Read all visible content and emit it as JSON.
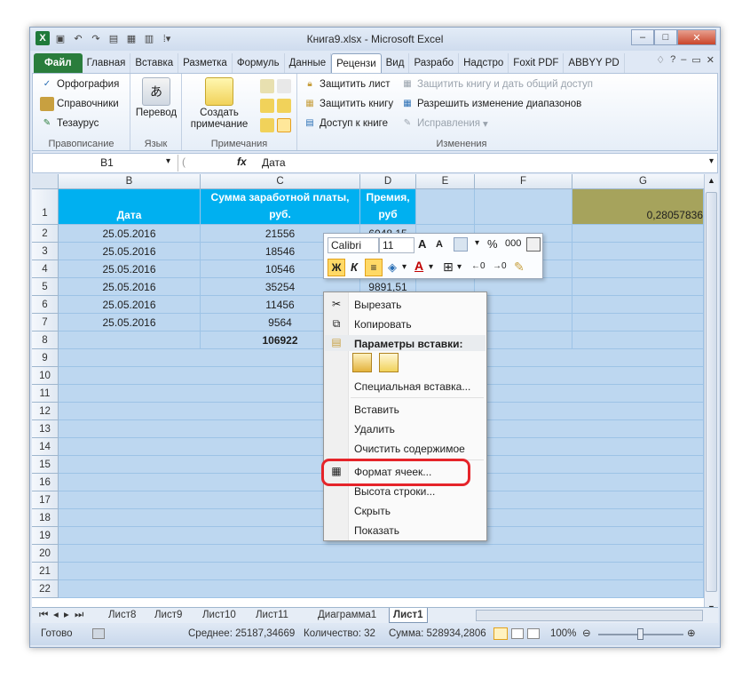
{
  "window": {
    "title": "Книга9.xlsx - Microsoft Excel"
  },
  "qat": {
    "excel_icon": "X"
  },
  "tabs": [
    {
      "label": "Файл"
    },
    {
      "label": "Главная"
    },
    {
      "label": "Вставка"
    },
    {
      "label": "Разметка"
    },
    {
      "label": "Формуль"
    },
    {
      "label": "Данные"
    },
    {
      "label": "Рецензи"
    },
    {
      "label": "Вид"
    },
    {
      "label": "Разрабо"
    },
    {
      "label": "Надстро"
    },
    {
      "label": "Foxit PDF"
    },
    {
      "label": "ABBYY PD"
    }
  ],
  "ribbon": {
    "spelling": "Орфография",
    "research": "Справочники",
    "thesaurus": "Тезаурус",
    "proofing": "Правописание",
    "translate": "Перевод",
    "language": "Язык",
    "new_comment_line1": "Создать",
    "new_comment_line2": "примечание",
    "comments": "Примечания",
    "protect_sheet": "Защитить лист",
    "protect_workbook": "Защитить книгу",
    "share_workbook": "Доступ к книге",
    "protect_share": "Защитить книгу и дать общий доступ",
    "allow_ranges": "Разрешить изменение диапазонов",
    "track_changes": "Исправления",
    "changes": "Изменения"
  },
  "formula_bar": {
    "name_box": "B1",
    "fx": "fx",
    "content": "Дата"
  },
  "columns": [
    "B",
    "C",
    "D",
    "E",
    "F",
    "G"
  ],
  "header_row": {
    "b": "Дата",
    "c1": "Сумма заработной платы,",
    "c2": "руб.",
    "d1": "Премия,",
    "d2": "руб",
    "g": "0,28057836"
  },
  "rows": [
    {
      "n": "2",
      "b": "25.05.2016",
      "c": "21556",
      "d": "6048,15"
    },
    {
      "n": "3",
      "b": "25.05.2016",
      "c": "18546",
      "d": ""
    },
    {
      "n": "4",
      "b": "25.05.2016",
      "c": "10546",
      "d": ""
    },
    {
      "n": "5",
      "b": "25.05.2016",
      "c": "35254",
      "d": "9891,51"
    },
    {
      "n": "6",
      "b": "25.05.2016",
      "c": "11456",
      "d": ""
    },
    {
      "n": "7",
      "b": "25.05.2016",
      "c": "9564",
      "d": ""
    },
    {
      "n": "8",
      "b": "",
      "c": "106922",
      "d": ""
    }
  ],
  "empty_rows": [
    "9",
    "10",
    "11",
    "12",
    "13",
    "14",
    "15",
    "16",
    "17",
    "18",
    "19",
    "20",
    "21",
    "22"
  ],
  "row1_num": "1",
  "mini_toolbar": {
    "font": "Calibri",
    "size": "11",
    "percent": "%",
    "thousands": "000"
  },
  "context_menu": {
    "cut": "Вырезать",
    "copy": "Копировать",
    "paste_options": "Параметры вставки:",
    "paste_special": "Специальная вставка...",
    "insert": "Вставить",
    "delete": "Удалить",
    "clear": "Очистить содержимое",
    "format_cells": "Формат ячеек...",
    "row_height": "Высота строки...",
    "hide": "Скрыть",
    "unhide": "Показать"
  },
  "sheets": [
    "Лист8",
    "Лист9",
    "Лист10",
    "Лист11",
    "Диаграмма1",
    "Лист1"
  ],
  "status": {
    "ready": "Готово",
    "average": "Среднее: 25187,34669",
    "count": "Количество: 32",
    "sum": "Сумма: 528934,2806",
    "zoom": "100%"
  },
  "colors": {
    "selection": "#bdd7f0",
    "header_blue": "#00b0f0",
    "olive": "#a6a35c",
    "highlight": "#e5242a"
  }
}
